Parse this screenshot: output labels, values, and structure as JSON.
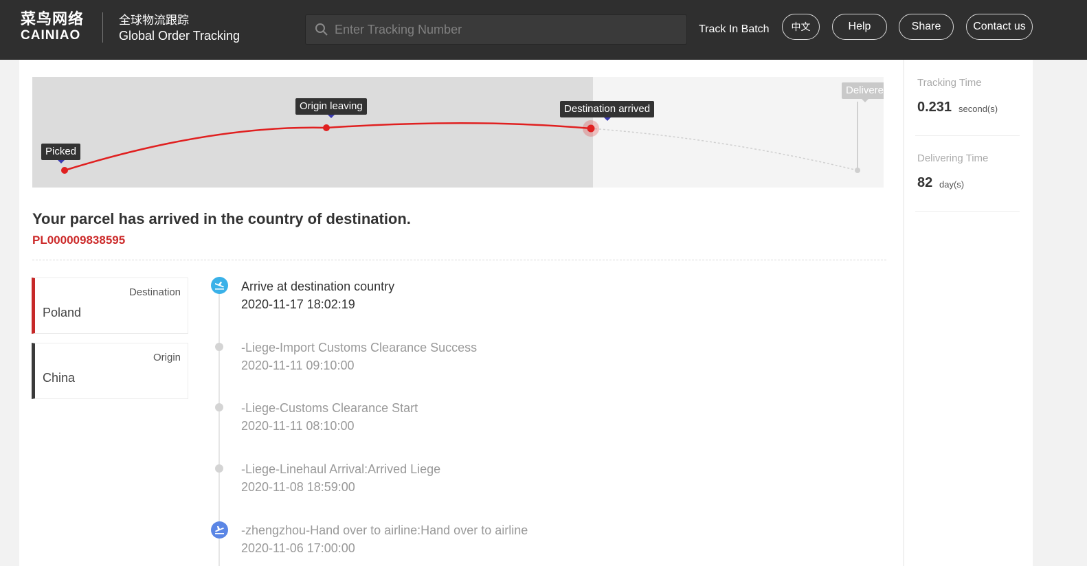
{
  "header": {
    "logo_cn": "菜鸟网络",
    "logo_en": "CAINIAO",
    "title_cn": "全球物流跟踪",
    "title_en": "Global Order Tracking",
    "search_placeholder": "Enter Tracking Number",
    "batch_label": "Track In Batch",
    "lang_label": "中文",
    "help_label": "Help",
    "share_label": "Share",
    "contact_label": "Contact us"
  },
  "route": {
    "stages": [
      "Picked",
      "Origin leaving",
      "Destination arrived",
      "Delivere"
    ],
    "current_stage": "Destination arrived",
    "accent_color": "#e02020"
  },
  "status": {
    "message": "Your parcel has arrived in the country of destination.",
    "tracking_number": "PL000009838595"
  },
  "cards": {
    "destination_label": "Destination",
    "destination_value": "Poland",
    "origin_label": "Origin",
    "origin_value": "China"
  },
  "events": [
    {
      "title": "Arrive at destination country",
      "time": "2020-11-17 18:02:19",
      "icon": "plane-landing-icon"
    },
    {
      "title": "-Liege-Import Customs Clearance Success",
      "time": "2020-11-11 09:10:00"
    },
    {
      "title": "-Liege-Customs Clearance Start",
      "time": "2020-11-11 08:10:00"
    },
    {
      "title": "-Liege-Linehaul Arrival:Arrived Liege",
      "time": "2020-11-08 18:59:00"
    },
    {
      "title": "-zhengzhou-Hand over to airline:Hand over to airline",
      "time": "2020-11-06 17:00:00",
      "icon": "plane-departure-icon"
    }
  ],
  "stats": {
    "tracking_time_label": "Tracking Time",
    "tracking_time_value": "0.231",
    "tracking_time_unit": "second(s)",
    "delivering_time_label": "Delivering Time",
    "delivering_time_value": "82",
    "delivering_time_unit": "day(s)"
  }
}
